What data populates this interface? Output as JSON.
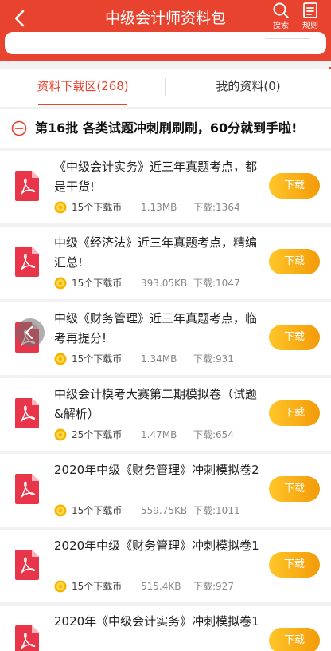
{
  "header": {
    "title": "中级会计师资料包",
    "search_label": "搜索",
    "rules_label": "规则",
    "accent": "#e8432f"
  },
  "tabs": [
    {
      "label": "资料下载区(268)",
      "active": true
    },
    {
      "label": "我的资料(0)",
      "active": false
    }
  ],
  "batch": {
    "title": "第16批 各类试题冲刺刷刷刷，60分就到手啦!",
    "icon": "collapse-minus-icon"
  },
  "download_label": "下载",
  "items": [
    {
      "title": "《中级会计实务》近三年真题考点，都是干货!",
      "coins": "15个下载币",
      "size": "1.13MB",
      "downloads": "下载:1364"
    },
    {
      "title": "中级《经济法》近三年真题考点，精编汇总!",
      "coins": "15个下载币",
      "size": "393.05KB",
      "downloads": "下载:1047"
    },
    {
      "title": "中级《财务管理》近三年真题考点，临考再提分!",
      "coins": "15个下载币",
      "size": "1.34MB",
      "downloads": "下载:931"
    },
    {
      "title": "中级会计模考大赛第二期模拟卷（试题&解析）",
      "coins": "25个下载币",
      "size": "1.47MB",
      "downloads": "下载:654"
    },
    {
      "title": "2020年中级《财务管理》冲刺模拟卷2",
      "coins": "15个下载币",
      "size": "559.75KB",
      "downloads": "下载:1011"
    },
    {
      "title": "2020年中级《财务管理》冲刺模拟卷1",
      "coins": "15个下载币",
      "size": "515.4KB",
      "downloads": "下载:927"
    },
    {
      "title": "2020年《中级会计实务》冲刺模拟卷1",
      "coins": "",
      "size": "",
      "downloads": ""
    }
  ]
}
